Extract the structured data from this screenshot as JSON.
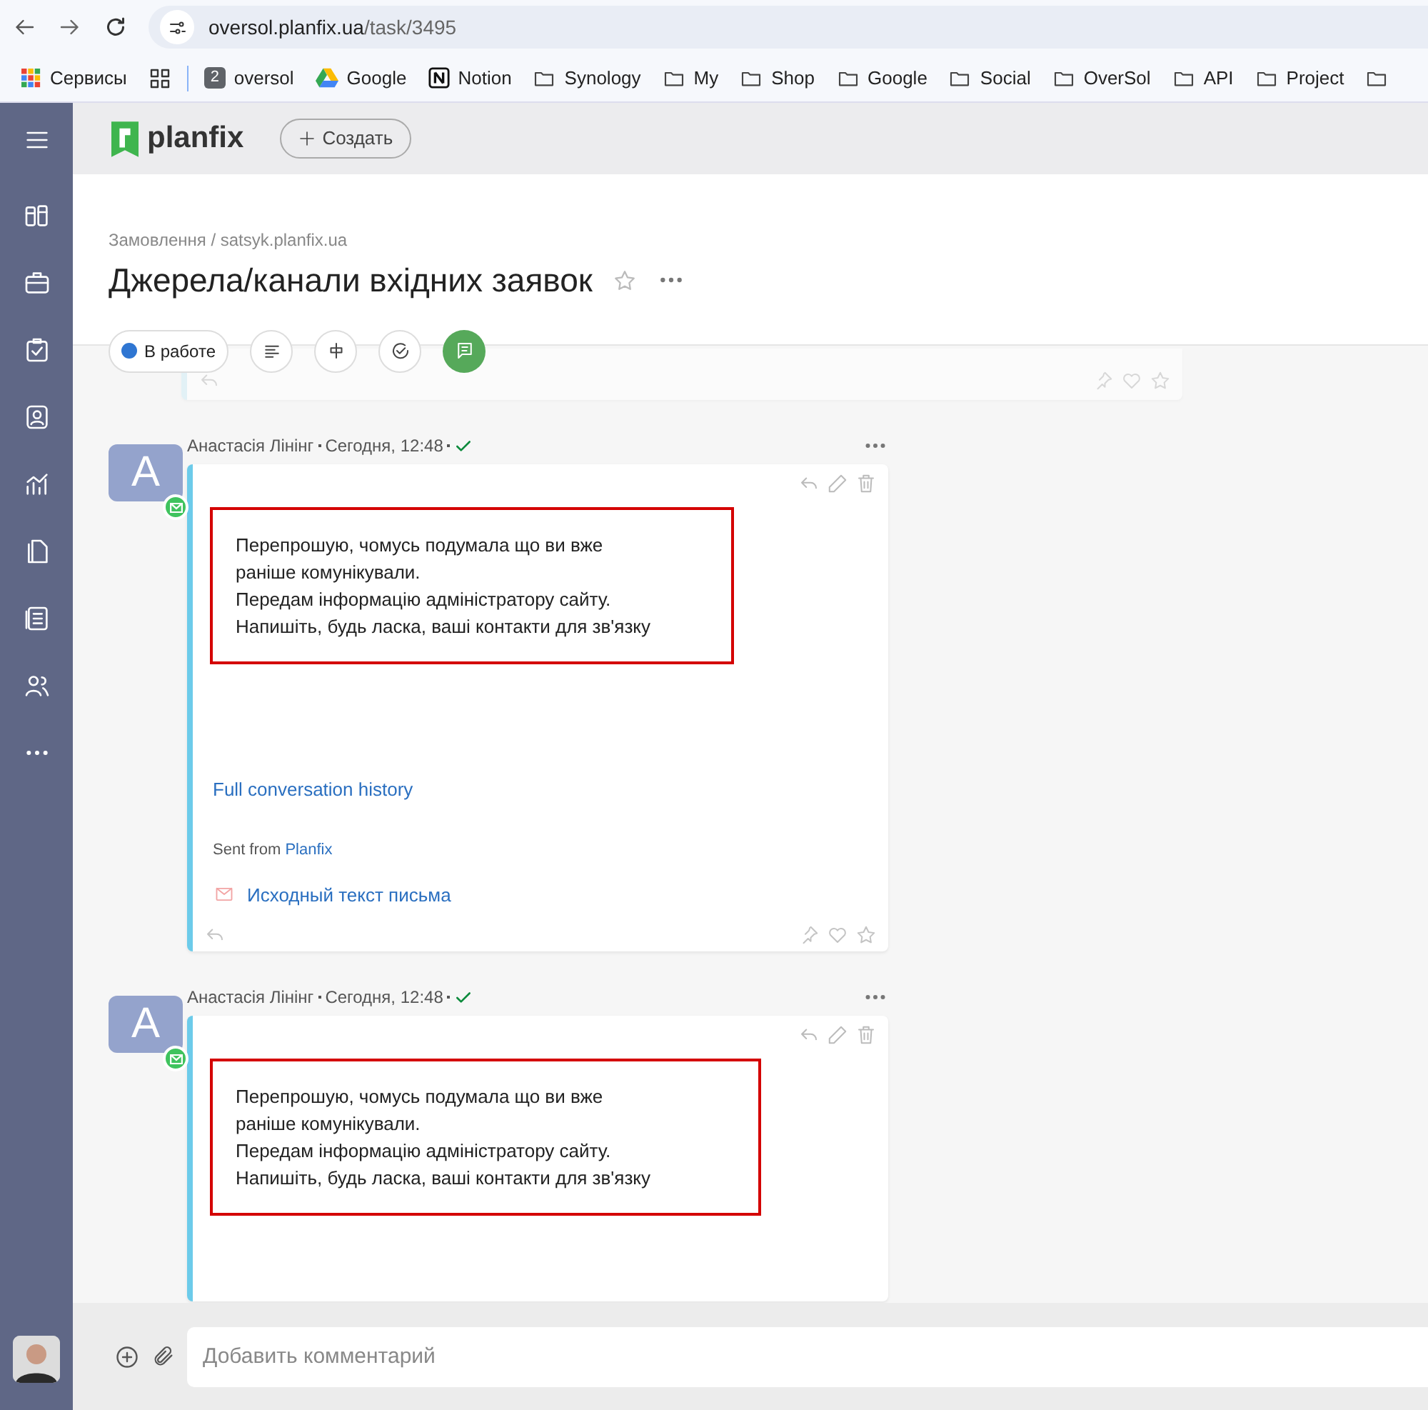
{
  "browser": {
    "url_host": "oversol.planfix.ua",
    "url_path": "/task/3495",
    "bookmarks": [
      {
        "kind": "apps",
        "label": "Сервисы"
      },
      {
        "kind": "grid"
      },
      {
        "kind": "badge",
        "badge": "2",
        "label": "oversol"
      },
      {
        "kind": "drive",
        "label": "Google"
      },
      {
        "kind": "notion",
        "label": "Notion"
      },
      {
        "kind": "folder",
        "label": "Synology"
      },
      {
        "kind": "folder",
        "label": "My"
      },
      {
        "kind": "folder",
        "label": "Shop"
      },
      {
        "kind": "folder",
        "label": "Google"
      },
      {
        "kind": "folder",
        "label": "Social"
      },
      {
        "kind": "folder",
        "label": "OverSol"
      },
      {
        "kind": "folder",
        "label": "API"
      },
      {
        "kind": "folder",
        "label": "Project"
      },
      {
        "kind": "folder"
      }
    ]
  },
  "app": {
    "logo": "planfix",
    "create_button": "Создать"
  },
  "task": {
    "breadcrumb": "Замовлення / satsyk.planfix.ua",
    "title": "Джерела/канали вхідних заявок",
    "status": {
      "label": "В работе",
      "color": "#2f76d2"
    }
  },
  "messages": [
    {
      "avatar": "A",
      "author": "Анастасія Лінінг",
      "time": "Сегодня, 12:48",
      "body": [
        "Перепрошую, чомусь подумала що ви вже",
        "раніше комунікували.",
        "Передам інформацію адміністратору сайту.",
        "Напишіть, будь ласка, ваші контакти для зв'язку"
      ],
      "link": "Full conversation history",
      "sent_from": "Sent from",
      "sent_from_link": "Planfix",
      "source": "Исходный текст письма"
    },
    {
      "avatar": "A",
      "author": "Анастасія Лінінг",
      "time": "Сегодня, 12:48",
      "body": [
        "Перепрошую, чомусь подумала що ви вже",
        "раніше комунікували.",
        "Передам інформацію адміністратору сайту.",
        "Напишіть, будь ласка, ваші контакти для зв'язку"
      ]
    }
  ],
  "comment": {
    "placeholder": "Добавить комментарий"
  }
}
